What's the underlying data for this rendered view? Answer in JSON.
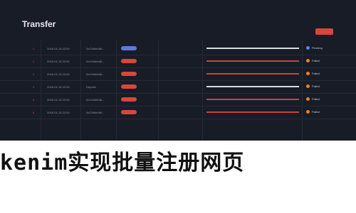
{
  "window": {
    "title": "Transfer",
    "top_button_color": "#d9463c"
  },
  "table": {
    "rows": [
      {
        "index": "1",
        "date": "2018-01-15 22:00",
        "account": "0x22d5e5d6...",
        "badge_color": "#5a7bdb",
        "bar_color": "light",
        "status": "Pending"
      },
      {
        "index": "2",
        "date": "2018-01-15 22:00",
        "account": "0x22d5e5d6...",
        "badge_color": "#d9463c",
        "bar_color": "red",
        "status": "Failed"
      },
      {
        "index": "3",
        "date": "2018-01-15 22:00",
        "account": "0x22d5e5d6...",
        "badge_color": "#d9463c",
        "bar_color": "red",
        "status": "Failed"
      },
      {
        "index": "4",
        "date": "2018-01-15 22:00",
        "account": "Deposit",
        "badge_color": "#d9463c",
        "bar_color": "light",
        "status": "Failed"
      },
      {
        "index": "5",
        "date": "2018-01-15 22:00",
        "account": "0x22d5e5d6...",
        "badge_color": "#d9463c",
        "bar_color": "red",
        "status": "Failed"
      },
      {
        "index": "6",
        "date": "2018-01-15 22:00",
        "account": "0x22d5e5d6...",
        "badge_color": "#d9463c",
        "bar_color": "red",
        "status": "Failed"
      }
    ],
    "status_colors": {
      "Pending": "#4f8df0",
      "Failed": "#e9812f"
    }
  },
  "caption": {
    "text": "kenim实现批量注册网页"
  }
}
